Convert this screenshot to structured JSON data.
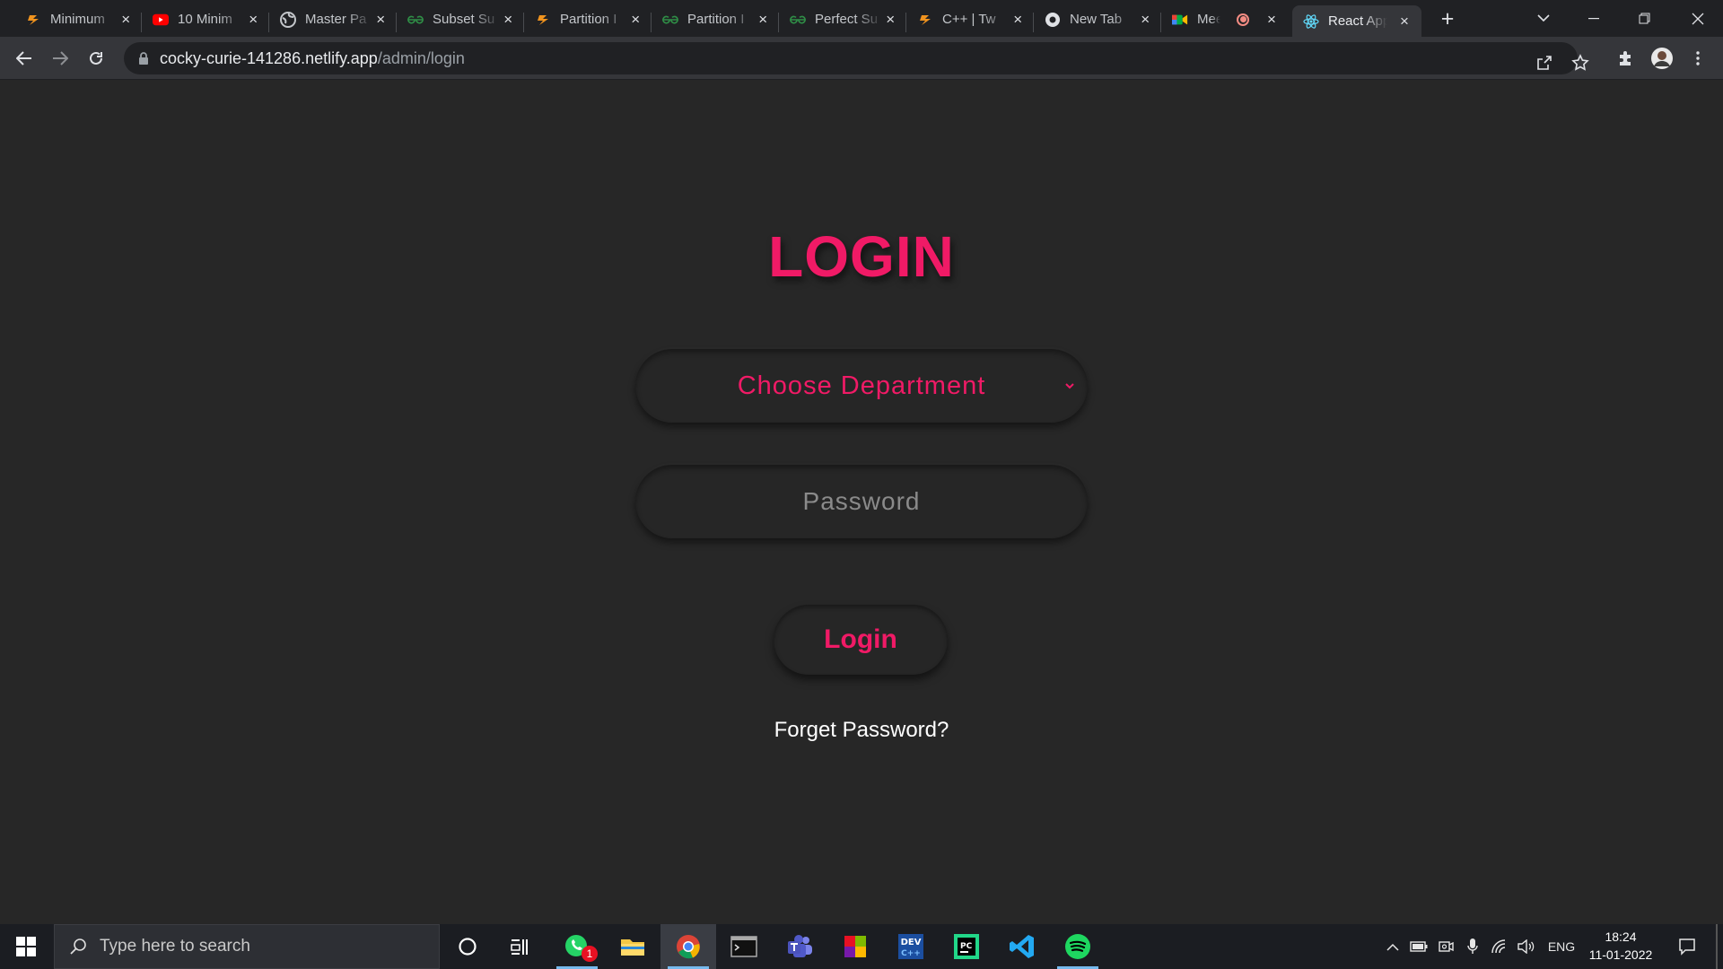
{
  "browser": {
    "tabs": [
      {
        "title": "Minimum",
        "icon": "coding-ninjas-icon"
      },
      {
        "title": "10 Minim",
        "icon": "youtube-icon"
      },
      {
        "title": "Master Pa",
        "icon": "globe-icon"
      },
      {
        "title": "Subset Su",
        "icon": "gfg-icon"
      },
      {
        "title": "Partition I",
        "icon": "coding-ninjas-icon"
      },
      {
        "title": "Partition I",
        "icon": "gfg-icon"
      },
      {
        "title": "Perfect Su",
        "icon": "gfg-icon"
      },
      {
        "title": "C++ | Tw",
        "icon": "coding-ninjas-icon"
      },
      {
        "title": "New Tab",
        "icon": "chrome-icon"
      },
      {
        "title": "Meet",
        "icon": "google-meet-icon"
      },
      {
        "title": "React App",
        "icon": "react-icon"
      }
    ],
    "active_tab_index": 10,
    "url_host": "cocky-curie-141286.netlify.app",
    "url_path": "/admin/login"
  },
  "page": {
    "title": "LOGIN",
    "department_select": {
      "selected": "Choose Department"
    },
    "password_field": {
      "placeholder": "Password",
      "value": ""
    },
    "login_button": "Login",
    "forget_password": "Forget Password?"
  },
  "colors": {
    "accent": "#f01a66",
    "page_bg": "#272727",
    "text": "#ffffff"
  },
  "taskbar": {
    "search_placeholder": "Type here to search",
    "apps": [
      "cortana-icon",
      "task-view-icon",
      "whatsapp-icon",
      "file-explorer-icon",
      "chrome-icon",
      "terminal-icon",
      "teams-icon",
      "office-icon",
      "devcpp-icon",
      "pycharm-icon",
      "vscode-icon",
      "spotify-icon"
    ],
    "whatsapp_badge": "1",
    "language": "ENG",
    "time": "18:24",
    "date": "11-01-2022"
  }
}
